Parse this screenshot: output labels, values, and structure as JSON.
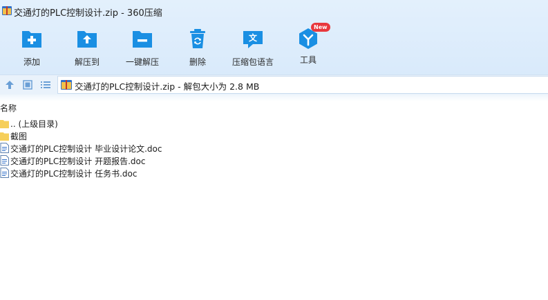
{
  "window": {
    "title": "交通灯的PLC控制设计.zip - 360压缩"
  },
  "toolbar": {
    "items": [
      {
        "label": "添加",
        "icon": "add-icon"
      },
      {
        "label": "解压到",
        "icon": "extract-to-icon"
      },
      {
        "label": "一键解压",
        "icon": "one-click-extract-icon"
      },
      {
        "label": "删除",
        "icon": "delete-icon"
      },
      {
        "label": "压缩包语言",
        "icon": "archive-language-icon"
      },
      {
        "label": "工具",
        "icon": "tools-icon",
        "badge": "New"
      }
    ]
  },
  "address": {
    "text": "交通灯的PLC控制设计.zip - 解包大小为 2.8 MB"
  },
  "columns": {
    "name": "名称"
  },
  "files": [
    {
      "name": ".. (上级目录)",
      "type": "folder"
    },
    {
      "name": "截图",
      "type": "folder"
    },
    {
      "name": "交通灯的PLC控制设计 毕业设计论文.doc",
      "type": "doc"
    },
    {
      "name": "交通灯的PLC控制设计 开题报告.doc",
      "type": "doc"
    },
    {
      "name": "交通灯的PLC控制设计 任务书.doc",
      "type": "doc"
    }
  ],
  "colors": {
    "icon_blue": "#1a8fe3",
    "header_bg": "#dceafb",
    "folder_yellow": "#f6cf5a",
    "badge_red": "#e8383d"
  }
}
